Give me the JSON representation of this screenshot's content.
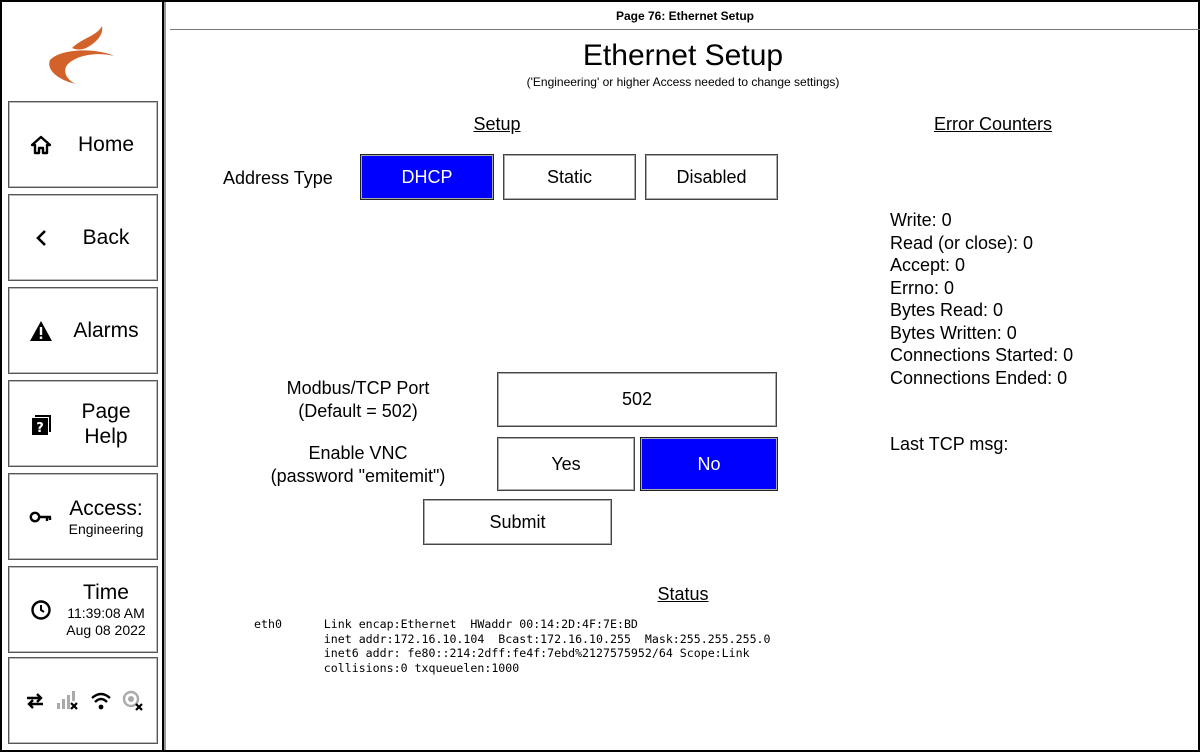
{
  "sidebar": {
    "items": [
      {
        "label": "Home",
        "icon": "home-icon"
      },
      {
        "label": "Back",
        "icon": "chevron-left-icon"
      },
      {
        "label": "Alarms",
        "icon": "warning-icon"
      },
      {
        "label": "Page Help",
        "icon": "help-icon"
      },
      {
        "label": "Access:",
        "sub": "Engineering",
        "icon": "key-icon"
      },
      {
        "label": "Time",
        "sub": "11:39:08 AM",
        "sub2": "Aug 08 2022",
        "icon": "clock-icon"
      }
    ],
    "status_icons": [
      "network-arrows-icon",
      "cellular-off-icon",
      "wifi-icon",
      "gps-off-icon"
    ]
  },
  "header": {
    "page_label": "Page 76: Ethernet Setup",
    "title": "Ethernet Setup",
    "subtitle": "('Engineering' or higher Access needed to change settings)"
  },
  "setup": {
    "heading": "Setup",
    "address_type_label": "Address Type",
    "address_options": [
      "DHCP",
      "Static",
      "Disabled"
    ],
    "address_selected": "DHCP",
    "port_label_1": "Modbus/TCP Port",
    "port_label_2": "(Default = 502)",
    "port_value": "502",
    "vnc_label_1": "Enable VNC",
    "vnc_label_2": "(password \"emitemit\")",
    "vnc_yes": "Yes",
    "vnc_no": "No",
    "vnc_selected": "No",
    "submit_label": "Submit"
  },
  "errors": {
    "heading": "Error Counters",
    "counters": [
      "Write: 0",
      "Read (or close): 0",
      "Accept: 0",
      "Errno: 0",
      "Bytes Read: 0",
      "Bytes Written: 0",
      "Connections Started: 0",
      "Connections Ended: 0"
    ],
    "last_tcp": "Last TCP msg:"
  },
  "status": {
    "heading": "Status",
    "text": "eth0      Link encap:Ethernet  HWaddr 00:14:2D:4F:7E:BD\n          inet addr:172.16.10.104  Bcast:172.16.10.255  Mask:255.255.255.0\n          inet6 addr: fe80::214:2dff:fe4f:7ebd%2127575952/64 Scope:Link\n          collisions:0 txqueuelen:1000"
  },
  "colors": {
    "selected": "#0000ff",
    "logo": "#d2622a"
  }
}
